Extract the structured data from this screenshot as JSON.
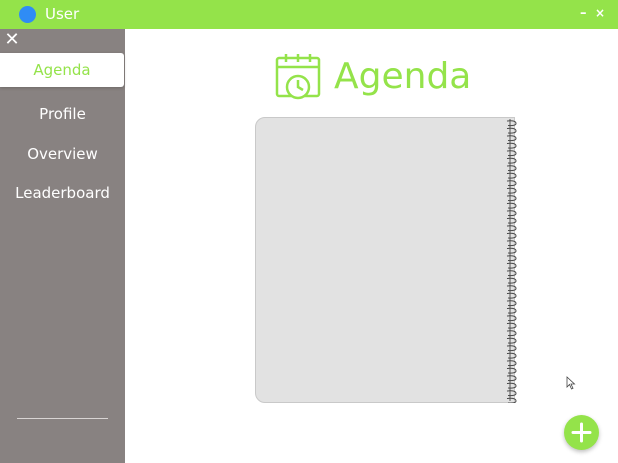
{
  "window": {
    "title": "User",
    "minimize_glyph": "–",
    "close_glyph": "×"
  },
  "sidebar": {
    "close_glyph": "✕",
    "items": [
      {
        "label": "Agenda",
        "active": true
      },
      {
        "label": "Profile",
        "active": false
      },
      {
        "label": "Overview",
        "active": false
      },
      {
        "label": "Leaderboard",
        "active": false
      }
    ]
  },
  "main": {
    "heading": "Agenda",
    "heading_icon": "calendar-clock-icon",
    "fab_icon": "plus-icon"
  },
  "colors": {
    "accent": "#94e34a",
    "sidebar": "#888281",
    "app_dot": "#2f8cf5",
    "notebook": "#e2e2e2"
  }
}
